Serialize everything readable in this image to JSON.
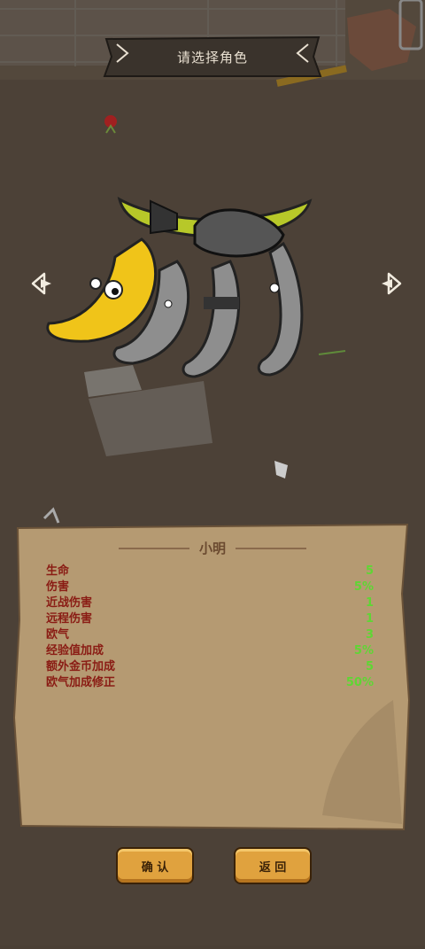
{
  "header": {
    "title": "请选择角色"
  },
  "navigation": {
    "prev_icon": "arrow-left-icon",
    "next_icon": "arrow-right-icon"
  },
  "character": {
    "name": "小明",
    "stats": [
      {
        "label": "生命",
        "value": "5"
      },
      {
        "label": "伤害",
        "value": "5%"
      },
      {
        "label": "近战伤害",
        "value": "1"
      },
      {
        "label": "远程伤害",
        "value": "1"
      },
      {
        "label": "欧气",
        "value": "3"
      },
      {
        "label": "经验值加成",
        "value": "5%"
      },
      {
        "label": "额外金币加成",
        "value": "5"
      },
      {
        "label": "欧气加成修正",
        "value": "50%"
      }
    ]
  },
  "buttons": {
    "confirm": "确 认",
    "back": "返 回"
  },
  "colors": {
    "stat_label": "#8a1c14",
    "stat_value": "#5fd634",
    "button": "#e0a23e"
  }
}
